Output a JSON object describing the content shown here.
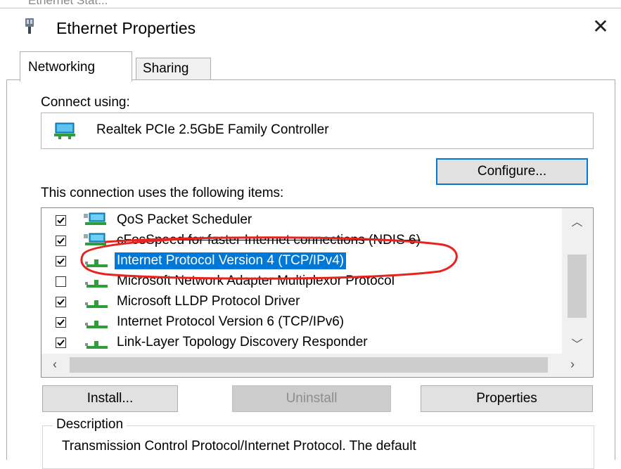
{
  "window": {
    "title": "Ethernet Properties",
    "close_glyph": "✕",
    "behind_title": "Ethernet Stat..."
  },
  "tabs": [
    {
      "label": "Networking",
      "active": true
    },
    {
      "label": "Sharing",
      "active": false
    }
  ],
  "connect_using": {
    "label": "Connect using:",
    "adapter": "Realtek PCIe 2.5GbE Family Controller",
    "configure_label": "Configure..."
  },
  "items": {
    "label": "This connection uses the following items:",
    "list": [
      {
        "label": "QoS Packet Scheduler",
        "checked": true,
        "icon": "network-service-icon",
        "selected": false
      },
      {
        "label": "cFosSpeed for faster Internet connections (NDIS 6)",
        "checked": true,
        "icon": "network-service-icon",
        "selected": false
      },
      {
        "label": "Internet Protocol Version 4 (TCP/IPv4)",
        "checked": true,
        "icon": "protocol-icon",
        "selected": true
      },
      {
        "label": "Microsoft Network Adapter Multiplexor Protocol",
        "checked": false,
        "icon": "protocol-icon",
        "selected": false
      },
      {
        "label": "Microsoft LLDP Protocol Driver",
        "checked": true,
        "icon": "protocol-icon",
        "selected": false
      },
      {
        "label": "Internet Protocol Version 6 (TCP/IPv6)",
        "checked": true,
        "icon": "protocol-icon",
        "selected": false
      },
      {
        "label": "Link-Layer Topology Discovery Responder",
        "checked": true,
        "icon": "protocol-icon",
        "selected": false
      }
    ]
  },
  "buttons": {
    "install": "Install...",
    "uninstall": "Uninstall",
    "properties": "Properties"
  },
  "description": {
    "legend": "Description",
    "text": "Transmission Control Protocol/Internet Protocol. The default"
  },
  "colors": {
    "selection": "#0078d7",
    "annotation": "#e8231f"
  }
}
